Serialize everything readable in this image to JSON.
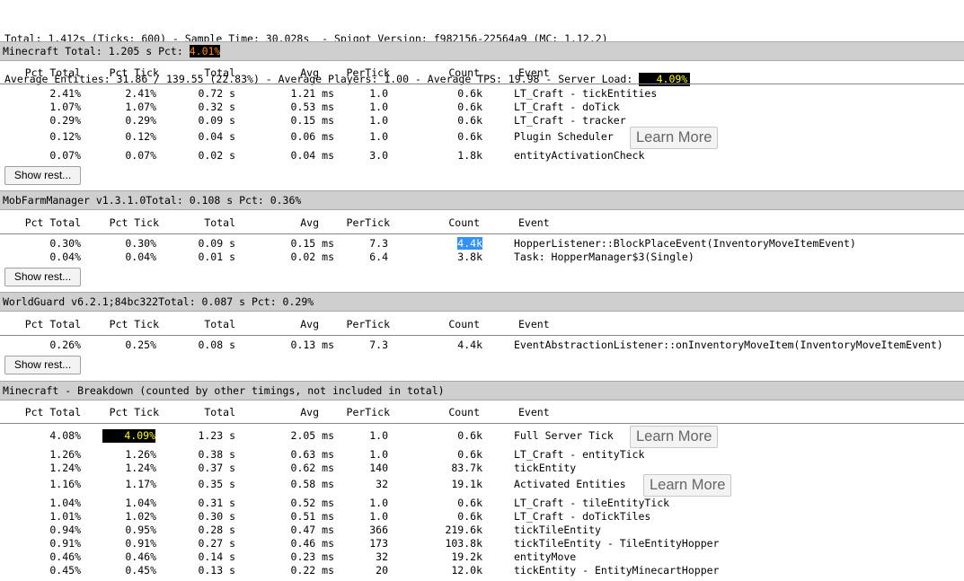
{
  "summary": {
    "line1": "Total: 1.412s (Ticks: 600) - Sample Time: 30.028s  - Spigot Version: f982156-22564a9 (MC: 1.12.2)",
    "line2_prefix": "Average Entities: 31.86 / 139.55 (22.83%) - Average Players: 1.00 - Average TPS: 19.98 - Server Load: ",
    "server_load": "4.09%"
  },
  "headers": {
    "pct_total": "Pct Total",
    "pct_tick": "Pct Tick",
    "total": "Total",
    "avg": "Avg",
    "per_tick": "PerTick",
    "count": "Count",
    "event": "Event"
  },
  "buttons": {
    "show_rest": "Show rest...",
    "learn_more": "Learn More"
  },
  "sections": [
    {
      "title_prefix": "Minecraft Total: 1.205 s Pct: ",
      "title_pct": "4.01%",
      "rows": [
        {
          "pct_total": "2.41%",
          "pct_tick": "2.41%",
          "total": "0.72 s",
          "avg": "1.21 ms",
          "per_tick": "1.0",
          "count": "0.6k",
          "event": "LT_Craft - tickEntities"
        },
        {
          "pct_total": "1.07%",
          "pct_tick": "1.07%",
          "total": "0.32 s",
          "avg": "0.53 ms",
          "per_tick": "1.0",
          "count": "0.6k",
          "event": "LT_Craft - doTick"
        },
        {
          "pct_total": "0.29%",
          "pct_tick": "0.29%",
          "total": "0.09 s",
          "avg": "0.15 ms",
          "per_tick": "1.0",
          "count": "0.6k",
          "event": "LT_Craft - tracker"
        },
        {
          "pct_total": "0.12%",
          "pct_tick": "0.12%",
          "total": "0.04 s",
          "avg": "0.06 ms",
          "per_tick": "1.0",
          "count": "0.6k",
          "event": "Plugin Scheduler"
        },
        {
          "pct_total": "0.07%",
          "pct_tick": "0.07%",
          "total": "0.02 s",
          "avg": "0.04 ms",
          "per_tick": "3.0",
          "count": "1.8k",
          "event": "entityActivationCheck"
        }
      ]
    },
    {
      "title": "MobFarmManager v1.3.1.0Total: 0.108 s Pct: 0.36%",
      "rows": [
        {
          "pct_total": "0.30%",
          "pct_tick": "0.30%",
          "total": "0.09 s",
          "avg": "0.15 ms",
          "per_tick": "7.3",
          "count": "4.4k",
          "event": "HopperListener::BlockPlaceEvent(InventoryMoveItemEvent)"
        },
        {
          "pct_total": "0.04%",
          "pct_tick": "0.04%",
          "total": "0.01 s",
          "avg": "0.02 ms",
          "per_tick": "6.4",
          "count": "3.8k",
          "event": "Task: HopperManager$3(Single)"
        }
      ]
    },
    {
      "title": "WorldGuard v6.2.1;84bc322Total: 0.087 s Pct: 0.29%",
      "rows": [
        {
          "pct_total": "0.26%",
          "pct_tick": "0.25%",
          "total": "0.08 s",
          "avg": "0.13 ms",
          "per_tick": "7.3",
          "count": "4.4k",
          "event": "EventAbstractionListener::onInventoryMoveItem(InventoryMoveItemEvent)"
        }
      ]
    },
    {
      "title": "Minecraft - Breakdown (counted by other timings, not included in total)",
      "rows": [
        {
          "pct_total": "4.08%",
          "pct_tick": "4.09%",
          "total": "1.23 s",
          "avg": "2.05 ms",
          "per_tick": "1.0",
          "count": "0.6k",
          "event": "Full Server Tick"
        },
        {
          "pct_total": "1.26%",
          "pct_tick": "1.26%",
          "total": "0.38 s",
          "avg": "0.63 ms",
          "per_tick": "1.0",
          "count": "0.6k",
          "event": "LT_Craft - entityTick"
        },
        {
          "pct_total": "1.24%",
          "pct_tick": "1.24%",
          "total": "0.37 s",
          "avg": "0.62 ms",
          "per_tick": "140",
          "count": "83.7k",
          "event": "tickEntity"
        },
        {
          "pct_total": "1.16%",
          "pct_tick": "1.17%",
          "total": "0.35 s",
          "avg": "0.58 ms",
          "per_tick": "32",
          "count": "19.1k",
          "event": "Activated Entities"
        },
        {
          "pct_total": "1.04%",
          "pct_tick": "1.04%",
          "total": "0.31 s",
          "avg": "0.52 ms",
          "per_tick": "1.0",
          "count": "0.6k",
          "event": "LT_Craft - tileEntityTick"
        },
        {
          "pct_total": "1.01%",
          "pct_tick": "1.02%",
          "total": "0.30 s",
          "avg": "0.51 ms",
          "per_tick": "1.0",
          "count": "0.6k",
          "event": "LT_Craft - doTickTiles"
        },
        {
          "pct_total": "0.94%",
          "pct_tick": "0.95%",
          "total": "0.28 s",
          "avg": "0.47 ms",
          "per_tick": "366",
          "count": "219.6k",
          "event": "tickTileEntity"
        },
        {
          "pct_total": "0.91%",
          "pct_tick": "0.91%",
          "total": "0.27 s",
          "avg": "0.46 ms",
          "per_tick": "173",
          "count": "103.8k",
          "event": "tickTileEntity - TileEntityHopper"
        },
        {
          "pct_total": "0.46%",
          "pct_tick": "0.46%",
          "total": "0.14 s",
          "avg": "0.23 ms",
          "per_tick": "32",
          "count": "19.2k",
          "event": "entityMove"
        },
        {
          "pct_total": "0.45%",
          "pct_tick": "0.45%",
          "total": "0.13 s",
          "avg": "0.22 ms",
          "per_tick": "20",
          "count": "12.0k",
          "event": "tickEntity - EntityMinecartHopper"
        }
      ]
    }
  ]
}
